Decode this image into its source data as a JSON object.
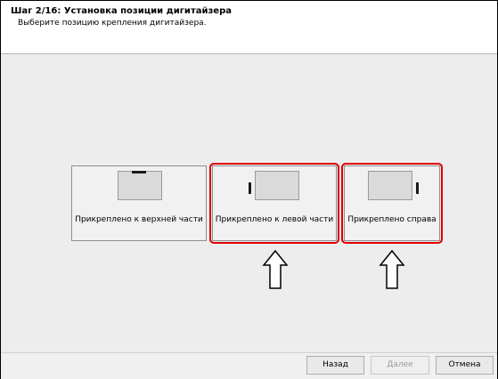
{
  "header": {
    "title": "Шаг 2/16: Установка позиции дигитайзера",
    "subtitle": "Выберите позицию крепления дигитайзера."
  },
  "options": [
    {
      "label": "Прикреплено к верхней части",
      "icon": "digitizer-top-icon",
      "highlighted": false
    },
    {
      "label": "Прикреплено к левой части",
      "icon": "digitizer-left-icon",
      "highlighted": true
    },
    {
      "label": "Прикреплено справа",
      "icon": "digitizer-right-icon",
      "highlighted": true
    }
  ],
  "annotations": {
    "highlight_color": "#e00000",
    "arrow_icon": "up-arrow-icon"
  },
  "footer": {
    "back_label": "Назад",
    "next_label": "Далее",
    "cancel_label": "Отмена",
    "next_disabled": true
  }
}
